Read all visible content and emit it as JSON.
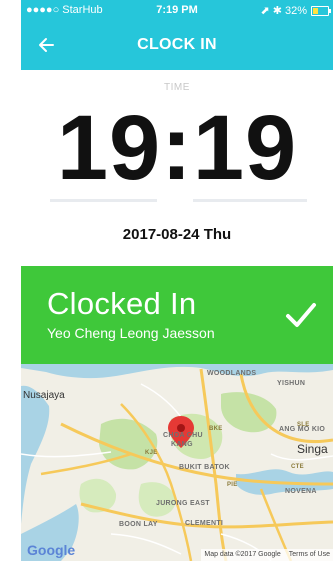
{
  "status_bar": {
    "carrier": "●●●●○ StarHub",
    "time": "7:19 PM",
    "right": "⬈ ✱ 32%"
  },
  "nav": {
    "title": "CLOCK IN"
  },
  "clock": {
    "label": "TIME",
    "value": "19:19",
    "date": "2017-08-24 Thu"
  },
  "banner": {
    "status": "Clocked In",
    "name": "Yeo Cheng Leong Jaesson",
    "color": "#3fc83a"
  },
  "map": {
    "labels": {
      "woodlands": "WOODLANDS",
      "yishun": "YISHUN",
      "nusajaya": "Nusajaya",
      "choa_chu_kang_1": "CHOA CHU",
      "choa_chu_kang_2": "KANG",
      "bukit_batok": "BUKIT BATOK",
      "ang_mo_kio": "ANG MO KIO",
      "singapore": "Singa",
      "jurong_east": "JURONG EAST",
      "boon_lay": "BOON LAY",
      "clementi": "CLEMENTI",
      "novena": "NOVENA",
      "sle": "SLE",
      "bke": "BKE",
      "kje": "KJE",
      "pie": "PIE",
      "cte": "CTE"
    },
    "google": "Google",
    "attribution": "Map data ©2017 Google",
    "terms": "Terms of Use"
  },
  "colors": {
    "header": "#26c6da",
    "banner": "#3fc83a",
    "marker": "#e53935"
  },
  "icons": {
    "back": "arrow-left-icon",
    "check": "check-icon",
    "marker": "map-marker-icon"
  }
}
